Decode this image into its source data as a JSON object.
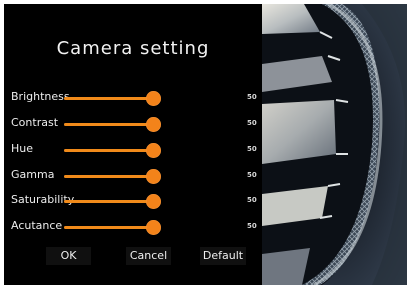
{
  "dialog": {
    "title": "Camera setting"
  },
  "settings": [
    {
      "label": "Brightness",
      "value": "50",
      "level": 1.0
    },
    {
      "label": "Contrast",
      "value": "50",
      "level": 1.0
    },
    {
      "label": "Hue",
      "value": "50",
      "level": 1.0
    },
    {
      "label": "Gamma",
      "value": "50",
      "level": 1.0
    },
    {
      "label": "Saturability",
      "value": "50",
      "level": 1.0
    },
    {
      "label": "Acutance",
      "value": "50",
      "level": 1.0
    }
  ],
  "buttons": {
    "ok": "OK",
    "cancel": "Cancel",
    "default": "Default"
  },
  "colors": {
    "accent": "#f3831a",
    "background": "#000000"
  }
}
